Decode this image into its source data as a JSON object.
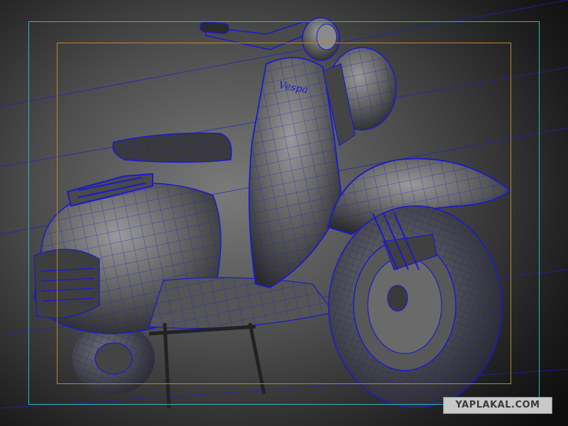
{
  "scene": {
    "subject": "wireframe-scooter",
    "badge_text": "Vespa",
    "wire_color": "#1a1ad0",
    "body_color": "#5e5e5e",
    "body_highlight": "#9a9a9a",
    "background_center": "#7a7a7a",
    "background_edge": "#0e0e0e"
  },
  "viewport": {
    "safe_frame_color": "#2fb8b8",
    "title_safe_color": "#b58a2a"
  },
  "watermark": {
    "text": "YAPLAKAL.COM"
  }
}
